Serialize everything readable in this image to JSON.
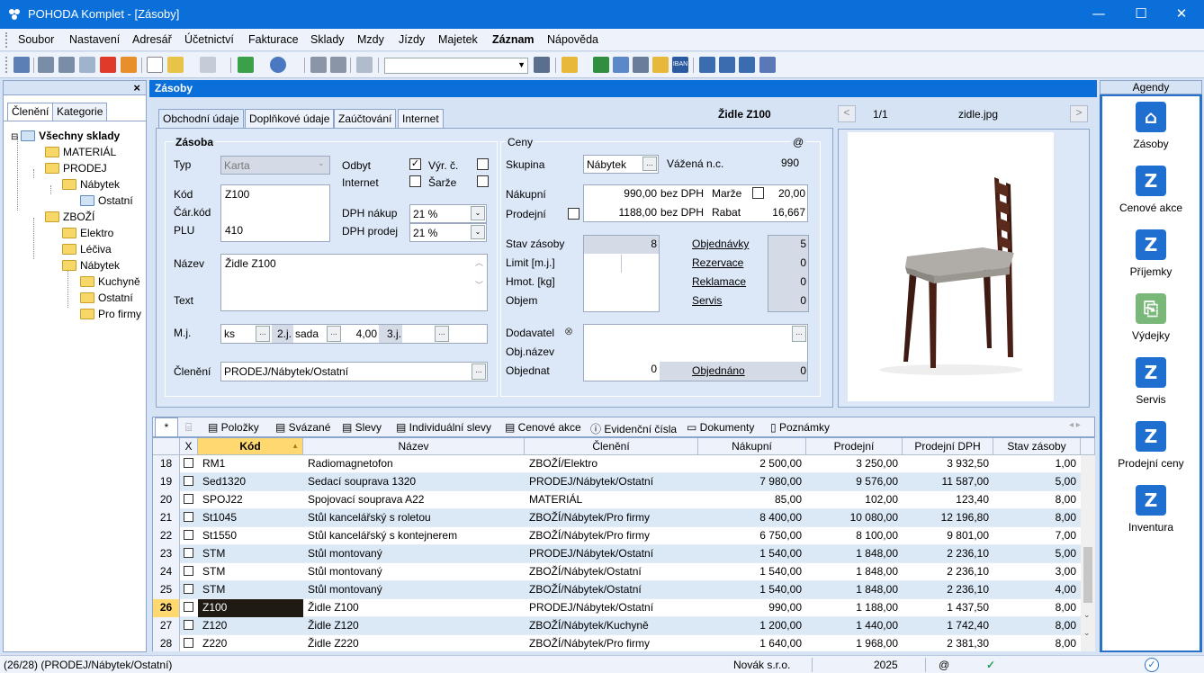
{
  "window": {
    "title": "POHODA Komplet - [Zásoby]",
    "minimize": "—",
    "maximize": "☐",
    "close": "✕"
  },
  "menu": [
    "Soubor",
    "Nastavení",
    "Adresář",
    "Účetnictví",
    "Fakturace",
    "Sklady",
    "Mzdy",
    "Jízdy",
    "Majetek",
    "Záznam",
    "Nápověda"
  ],
  "left": {
    "close": "×",
    "tabs": [
      "Členění",
      "Kategorie"
    ],
    "tree": [
      {
        "label": "Všechny sklady",
        "level": 0,
        "bold": true
      },
      {
        "label": "MATERIÁL",
        "level": 1
      },
      {
        "label": "PRODEJ",
        "level": 1
      },
      {
        "label": "Nábytek",
        "level": 2
      },
      {
        "label": "Ostatní",
        "level": 3
      },
      {
        "label": "ZBOŽÍ",
        "level": 1
      },
      {
        "label": "Elektro",
        "level": 2
      },
      {
        "label": "Léčiva",
        "level": 2
      },
      {
        "label": "Nábytek",
        "level": 2
      },
      {
        "label": "Kuchyně",
        "level": 3
      },
      {
        "label": "Ostatní",
        "level": 3
      },
      {
        "label": "Pro firmy",
        "level": 3
      }
    ]
  },
  "main": {
    "header": "Zásoby",
    "tabs": [
      "Obchodní údaje",
      "Doplňkové údaje",
      "Zaúčtování",
      "Internet"
    ],
    "record_title": "Židle Z100",
    "image": {
      "counter": "1/1",
      "filename": "zidle.jpg",
      "prev": "<",
      "next": ">"
    }
  },
  "zasoba": {
    "title": "Zásoba",
    "typ_label": "Typ",
    "typ": "Karta",
    "kod_label": "Kód",
    "kod": "Z100",
    "carkod_label": "Čár.kód",
    "plu_label": "PLU",
    "plu": "410",
    "nazev_label": "Název",
    "nazev": "Židle Z100",
    "text_label": "Text",
    "mj_label": "M.j.",
    "mj": "ks",
    "mj2_label": "2.j.",
    "mj2": "sada",
    "mj2_coef": "4,00",
    "mj3_label": "3.j.",
    "cleneni_label": "Členění",
    "cleneni": "PRODEJ/Nábytek/Ostatní",
    "odbyt": "Odbyt",
    "internet": "Internet",
    "vyr_c": "Výr. č.",
    "sarze": "Šarže",
    "dph_nakup_label": "DPH nákup",
    "dph_nakup": "21 %",
    "dph_prodej_label": "DPH prodej",
    "dph_prodej": "21 %"
  },
  "ceny": {
    "title": "Ceny",
    "at": "@",
    "skupina_label": "Skupina",
    "skupina": "Nábytek",
    "vazena_label": "Vážená n.c.",
    "vazena": "990",
    "nakupni_label": "Nákupní",
    "nakupni": "990,00",
    "bez_dph1": "bez DPH",
    "marze_label": "Marže",
    "marze": "20,00",
    "prodejni_label": "Prodejní",
    "prodejni": "1188,00",
    "bez_dph2": "bez DPH",
    "rabat_label": "Rabat",
    "rabat": "16,667",
    "stav_label": "Stav zásoby",
    "stav": "8",
    "limit_label": "Limit  [m.j.]",
    "hmot_label": "Hmot. [kg]",
    "objem_label": "Objem",
    "objednavky_label": "Objednávky",
    "objednavky": "5",
    "rezervace_label": "Rezervace",
    "rezervace": "0",
    "reklamace_label": "Reklamace",
    "reklamace": "0",
    "servis_label": "Servis",
    "servis": "0",
    "dodavatel_label": "Dodavatel",
    "objnazev_label": "Obj.název",
    "objednat_label": "Objednat",
    "objednat": "0",
    "objednano_label": "Objednáno",
    "objednano": "0"
  },
  "bottom_tabs": [
    "*",
    "Položky",
    "Svázané",
    "Slevy",
    "Individuální slevy",
    "Cenové akce",
    "Evidenční čísla",
    "Dokumenty",
    "Poznámky"
  ],
  "grid": {
    "headers": [
      "X",
      "Kód",
      "Název",
      "Členění",
      "Nákupní",
      "Prodejní",
      "Prodejní DPH",
      "Stav zásoby"
    ],
    "rows": [
      [
        "18",
        "RM1",
        "Radiomagnetofon",
        "ZBOŽÍ/Elektro",
        "2 500,00",
        "3 250,00",
        "3 932,50",
        "1,00"
      ],
      [
        "19",
        "Sed1320",
        "Sedací souprava 1320",
        "PRODEJ/Nábytek/Ostatní",
        "7 980,00",
        "9 576,00",
        "11 587,00",
        "5,00"
      ],
      [
        "20",
        "SPOJ22",
        "Spojovací souprava A22",
        "MATERIÁL",
        "85,00",
        "102,00",
        "123,40",
        "8,00"
      ],
      [
        "21",
        "St1045",
        "Stůl kancelářský s roletou",
        "ZBOŽÍ/Nábytek/Pro firmy",
        "8 400,00",
        "10 080,00",
        "12 196,80",
        "8,00"
      ],
      [
        "22",
        "St1550",
        "Stůl kancelářský s kontejnerem",
        "ZBOŽÍ/Nábytek/Pro firmy",
        "6 750,00",
        "8 100,00",
        "9 801,00",
        "7,00"
      ],
      [
        "23",
        "STM",
        "Stůl montovaný",
        "PRODEJ/Nábytek/Ostatní",
        "1 540,00",
        "1 848,00",
        "2 236,10",
        "5,00"
      ],
      [
        "24",
        "STM",
        "Stůl montovaný",
        "ZBOŽÍ/Nábytek/Ostatní",
        "1 540,00",
        "1 848,00",
        "2 236,10",
        "3,00"
      ],
      [
        "25",
        "STM",
        "Stůl montovaný",
        "ZBOŽÍ/Nábytek/Ostatní",
        "1 540,00",
        "1 848,00",
        "2 236,10",
        "4,00"
      ],
      [
        "26",
        "Z100",
        "Židle Z100",
        "PRODEJ/Nábytek/Ostatní",
        "990,00",
        "1 188,00",
        "1 437,50",
        "8,00"
      ],
      [
        "27",
        "Z120",
        "Židle Z120",
        "ZBOŽÍ/Nábytek/Kuchyně",
        "1 200,00",
        "1 440,00",
        "1 742,40",
        "8,00"
      ],
      [
        "28",
        "Z220",
        "Židle Z220",
        "ZBOŽÍ/Nábytek/Pro firmy",
        "1 640,00",
        "1 968,00",
        "2 381,30",
        "8,00"
      ]
    ],
    "selected_row": "26"
  },
  "agendy": {
    "title": "Agendy",
    "items": [
      "Zásoby",
      "Cenové akce",
      "Příjemky",
      "Výdejky",
      "Servis",
      "Prodejní ceny",
      "Inventura"
    ]
  },
  "status": {
    "left": "(26/28) (PRODEJ/Nábytek/Ostatní)",
    "company": "Novák s.r.o.",
    "year": "2025",
    "at": "@",
    "check": "✓"
  },
  "colors": {
    "titlebar": "#0a6fd8",
    "accent": "#1e6fd0",
    "selected_row": "#1f1a12",
    "sort_header": "#ffd870"
  }
}
